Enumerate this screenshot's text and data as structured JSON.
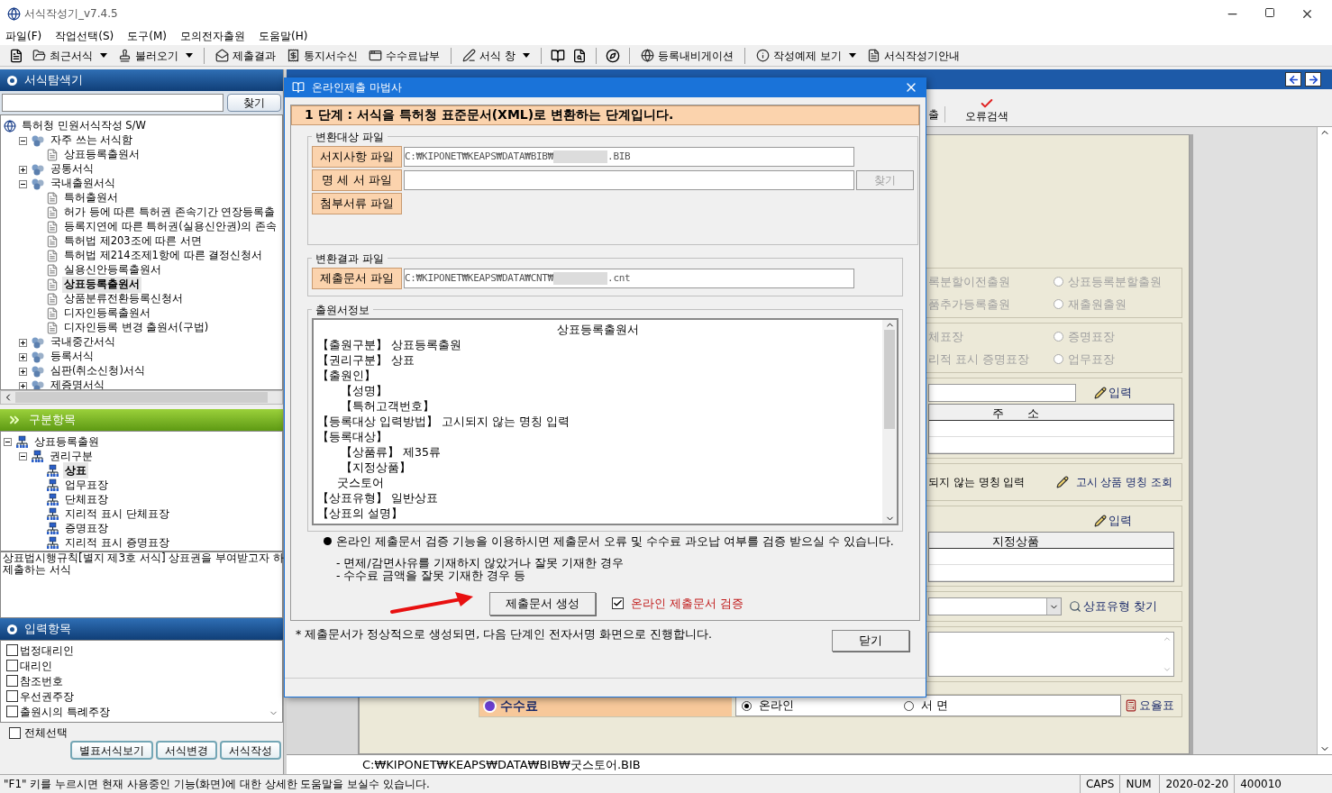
{
  "window": {
    "title": "서식작성기_v7.4.5"
  },
  "menu": [
    "파일(F)",
    "작업선택(S)",
    "도구(M)",
    "모의전자출원",
    "도움말(H)"
  ],
  "toolbar": [
    {
      "kind": "icon"
    },
    {
      "kind": "dropdown",
      "label": "최근서식"
    },
    {
      "kind": "dropdown",
      "label": "불러오기"
    },
    {
      "kind": "separator"
    },
    {
      "kind": "button",
      "label": "제출결과"
    },
    {
      "kind": "button",
      "label": "통지서수신"
    },
    {
      "kind": "button",
      "label": "수수료납부"
    },
    {
      "kind": "separator"
    },
    {
      "kind": "dropdown",
      "label": "서식 창"
    },
    {
      "kind": "separator"
    },
    {
      "kind": "icon"
    },
    {
      "kind": "icon"
    },
    {
      "kind": "separator"
    },
    {
      "kind": "icon"
    },
    {
      "kind": "separator"
    },
    {
      "kind": "button",
      "label": "등록내비게이션"
    },
    {
      "kind": "separator"
    },
    {
      "kind": "dropdown",
      "label": "작성예제 보기"
    },
    {
      "kind": "button",
      "label": "서식작성기안내"
    }
  ],
  "explorer": {
    "title": "서식탐색기",
    "search_button": "찾기",
    "tree": [
      {
        "label": "특허청 민원서식작성 S/W",
        "kind": "root",
        "selected": false,
        "children": [
          {
            "label": "자주 쓰는 서식함",
            "kind": "folder",
            "expanded": true,
            "selected": false,
            "children": [
              {
                "label": "상표등록출원서",
                "kind": "doc",
                "selected": false
              }
            ]
          },
          {
            "label": "공통서식",
            "kind": "folder",
            "expanded": false,
            "selected": false
          },
          {
            "label": "국내출원서식",
            "kind": "folder",
            "expanded": true,
            "selected": false,
            "children": [
              {
                "label": "특허출원서",
                "kind": "doc",
                "selected": false
              },
              {
                "label": "허가 등에 따른 특허권 존속기간 연장등록출",
                "kind": "doc",
                "selected": false
              },
              {
                "label": "등록지연에 따른 특허권(실용신안권)의 존속",
                "kind": "doc",
                "selected": false
              },
              {
                "label": "특허법 제203조에 따른 서면",
                "kind": "doc",
                "selected": false
              },
              {
                "label": "특허법 제214조제1항에 따른 결정신청서",
                "kind": "doc",
                "selected": false
              },
              {
                "label": "실용신안등록출원서",
                "kind": "doc",
                "selected": false
              },
              {
                "label": "상표등록출원서",
                "kind": "doc",
                "selected": true
              },
              {
                "label": "상품분류전환등록신청서",
                "kind": "doc",
                "selected": false
              },
              {
                "label": "디자인등록출원서",
                "kind": "doc",
                "selected": false
              },
              {
                "label": "디자인등록 변경 출원서(구법)",
                "kind": "doc",
                "selected": false
              }
            ]
          },
          {
            "label": "국내중간서식",
            "kind": "folder",
            "expanded": false,
            "selected": false
          },
          {
            "label": "등록서식",
            "kind": "folder",
            "expanded": false,
            "selected": false
          },
          {
            "label": "심판(취소신청)서식",
            "kind": "folder",
            "expanded": false,
            "selected": false
          },
          {
            "label": "제증명서식",
            "kind": "folder",
            "expanded": false,
            "selected": false
          }
        ]
      }
    ]
  },
  "category": {
    "title": "구분항목",
    "tree": [
      {
        "label": "상표등록출원",
        "kind": "node",
        "expanded": true,
        "selected": false,
        "children": [
          {
            "label": "권리구분",
            "kind": "node",
            "expanded": true,
            "selected": false,
            "children": [
              {
                "label": "상표",
                "kind": "node",
                "selected": true
              },
              {
                "label": "업무표장",
                "kind": "node",
                "selected": false
              },
              {
                "label": "단체표장",
                "kind": "node",
                "selected": false
              },
              {
                "label": "지리적 표시 단체표장",
                "kind": "node",
                "selected": false
              },
              {
                "label": "증명표장",
                "kind": "node",
                "selected": false
              },
              {
                "label": "지리적 표시 증명표장",
                "kind": "node",
                "selected": false
              }
            ]
          }
        ]
      }
    ]
  },
  "description": [
    "상표법시행규칙[별지 제3호 서식] 상표권을 부여받고자 하",
    "제출하는 서식"
  ],
  "inputs": {
    "title": "입력항목",
    "items": [
      {
        "label": "법정대리인",
        "checked": false
      },
      {
        "label": "대리인",
        "checked": false
      },
      {
        "label": "참조번호",
        "checked": false
      },
      {
        "label": "우선권주장",
        "checked": false
      },
      {
        "label": "출원시의 특례주장",
        "checked": false
      }
    ],
    "select_all": {
      "label": "전체선택",
      "checked": false
    },
    "buttons": [
      "별표서식보기",
      "서식변경",
      "서식작성"
    ]
  },
  "form": {
    "toolbar": [
      "출",
      "오류검색"
    ],
    "sections": [
      {
        "kind": "radios",
        "items": [
          {
            "label": "록분할이전출원",
            "kind": "label"
          },
          {
            "label": "상표등록분할출원",
            "kind": "radio",
            "selected": false
          },
          {
            "label": "품추가등록출원",
            "kind": "label"
          },
          {
            "label": "재출원출원",
            "kind": "radio",
            "selected": false
          }
        ]
      },
      {
        "kind": "radios",
        "items": [
          {
            "label": "체표장",
            "kind": "label"
          },
          {
            "label": "증명표장",
            "kind": "radio",
            "selected": false
          },
          {
            "label": "리적 표시 증명표장",
            "kind": "label"
          },
          {
            "label": "업무표장",
            "kind": "radio",
            "selected": false
          }
        ]
      },
      {
        "kind": "table_with_field",
        "action": "입력",
        "header": "주　　소"
      },
      {
        "kind": "text",
        "text": "되지 않는 명칭 입력",
        "action": "고시 상품 명칭 조회"
      },
      {
        "kind": "table",
        "action": "입력",
        "header": "지정상품"
      },
      {
        "kind": "select",
        "action": "상표유형 찾기"
      },
      {
        "kind": "textarea"
      }
    ],
    "fee": {
      "title": "수수료",
      "options": [
        {
          "label": "온라인",
          "selected": true
        },
        {
          "label": "서 면",
          "selected": false
        }
      ],
      "action": "요율표"
    },
    "path": "C:₩KIPONET₩KEAPS₩DATA₩BIB₩굿스토어.BIB"
  },
  "dialog": {
    "title": "온라인제출 마법사",
    "step": "1 단계 : 서식을 특허청 표준문서(XML)로 변환하는 단계입니다.",
    "source_group": {
      "title": "변환대상 파일",
      "rows": [
        {
          "label": "서지사항 파일",
          "value_start": "C:₩KIPONET₩KEAPS₩DATA₩BIB₩",
          "value_end": ".BIB",
          "kind": "field"
        },
        {
          "label": "명 세 서 파일",
          "kind": "field",
          "button": "찾기",
          "button_disabled": true
        },
        {
          "label": "첨부서류 파일",
          "kind": "label"
        }
      ]
    },
    "result_group": {
      "title": "변환결과 파일",
      "rows": [
        {
          "label": "제출문서 파일",
          "value_start": "C:₩KIPONET₩KEAPS₩DATA₩CNT₩",
          "value_end": ".cnt",
          "kind": "field"
        }
      ]
    },
    "info_group": {
      "title": "출원서정보",
      "lines": [
        {
          "text": "상표등록출원서",
          "kind": "title"
        },
        {
          "text": "【출원구분】  상표등록출원",
          "kind": "line"
        },
        {
          "text": "【권리구분】  상표",
          "kind": "line"
        },
        {
          "text": "【출원인】",
          "kind": "line"
        },
        {
          "text": "【성명】",
          "kind": "sub"
        },
        {
          "text": "【특허고객번호】",
          "kind": "sub"
        },
        {
          "text": "【등록대상 입력방법】  고시되지 않는 명칭 입력",
          "kind": "line"
        },
        {
          "text": "【등록대상】",
          "kind": "line"
        },
        {
          "text": "【상품류】  제35류",
          "kind": "sub"
        },
        {
          "text": "【지정상품】",
          "kind": "sub"
        },
        {
          "text": "굿스토어",
          "kind": "value"
        },
        {
          "text": "【상표유형】  일반상표",
          "kind": "line"
        },
        {
          "text": "【상표의 설명】",
          "kind": "line"
        }
      ]
    },
    "notice": "온라인 제출문서 검증 기능을 이용하시면 제출문서 오류 및 수수료 과오납 여부를 검증 받으실 수 있습니다.",
    "notes": [
      "- 면제/감면사유를 기재하지 않았거나 잘못 기재한 경우",
      "- 수수료 금액을 잘못 기재한 경우 등"
    ],
    "generate_button": "제출문서 생성",
    "verify": {
      "label": "온라인 제출문서 검증",
      "checked": true
    },
    "footer": "* 제출문서가 정상적으로 생성되면, 다음 단계인 전자서명 화면으로 진행합니다.",
    "close_button": "닫기"
  },
  "status_bar": {
    "help": "\"F1\" 키를 누르시면 현재 사용중인 기능(화면)에 대한 상세한 도움말을 보실수 있습니다.",
    "cells": [
      "CAPS",
      "NUM",
      "2020-02-20",
      "400010"
    ]
  }
}
